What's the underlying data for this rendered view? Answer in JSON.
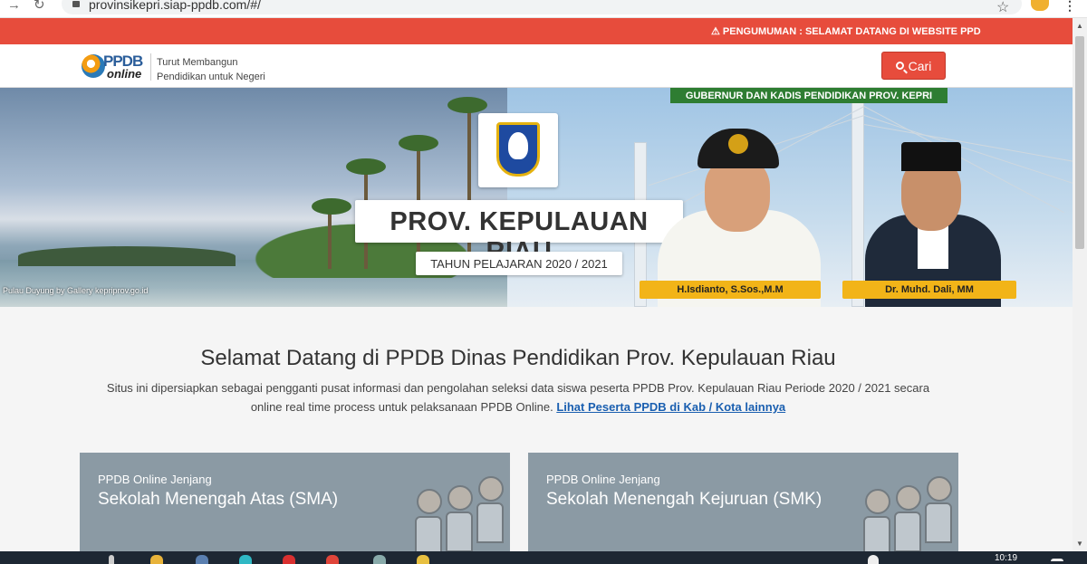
{
  "browser": {
    "url": "provinsikepri.siap-ppdb.com/#/",
    "back_icon": "arrow-right-icon",
    "reload_icon": "reload-icon"
  },
  "announcement": {
    "text": "⚠ PENGUMUMAN : SELAMAT DATANG DI WEBSITE PPD"
  },
  "header": {
    "logo_ppdb": "PPDB",
    "logo_online": "online",
    "tagline_line1": "Turut Membangun",
    "tagline_line2": "Pendidikan untuk Negeri",
    "search_label": "Cari"
  },
  "banner": {
    "caption": "Pulau Duyung by Gallery kepriprov.go.id",
    "province_title": "PROV. KEPULAUAN RIAU",
    "year": "TAHUN PELAJARAN 2020 / 2021",
    "officials_heading": "GUBERNUR DAN KADIS PENDIDIKAN PROV. KEPRI",
    "official_1": "H.Isdianto, S.Sos.,M.M",
    "official_2": "Dr. Muhd. Dali, MM"
  },
  "welcome": {
    "title": "Selamat Datang di PPDB Dinas Pendidikan Prov. Kepulauan Riau",
    "desc_line1": "Situs ini dipersiapkan sebagai pengganti pusat informasi dan pengolahan seleksi data siswa peserta PPDB Prov. Kepulauan Riau Periode 2020 / 2021 secara",
    "desc_line2": "online real time process untuk pelaksanaan PPDB Online.",
    "link": "Lihat Peserta PPDB di Kab / Kota lainnya"
  },
  "cards": [
    {
      "subtitle": "PPDB Online Jenjang",
      "title": "Sekolah Menengah Atas (SMA)"
    },
    {
      "subtitle": "PPDB Online Jenjang",
      "title": "Sekolah Menengah Kejuruan (SMK)"
    }
  ],
  "taskbar": {
    "time": "10:19"
  },
  "colors": {
    "accent": "#e74c3c",
    "green_banner": "#2e7d32",
    "name_tag": "#f2b418",
    "card": "#8b9aa4"
  }
}
